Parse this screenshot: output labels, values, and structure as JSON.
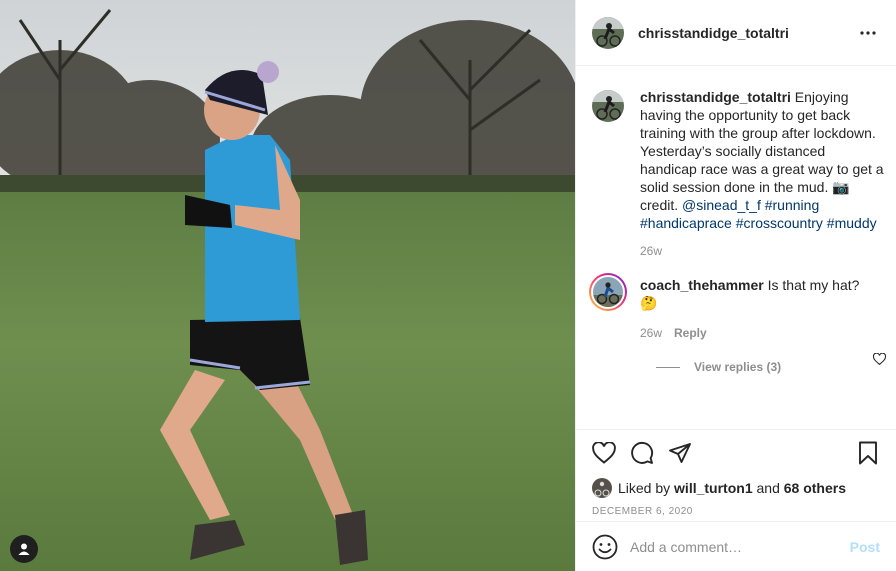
{
  "header": {
    "username": "chrisstandidge_totaltri",
    "more_icon": "more-horizontal-icon"
  },
  "caption": {
    "username": "chrisstandidge_totaltri",
    "text_before": " Enjoying having the opportunity to get back training with the group after lockdown. Yesterday’s socially distanced handicap race was a great way to get a solid session done in the mud. 📷credit. ",
    "mention": "@sinead_t_f",
    "hashtags": [
      "#running",
      "#handicaprace",
      "#crosscountry",
      "#muddy"
    ],
    "age": "26w"
  },
  "comments": [
    {
      "username": "coach_thehammer",
      "text": " Is that my hat? 🤔",
      "age": "26w",
      "reply_label": "Reply",
      "view_replies_label": "View replies (3)"
    }
  ],
  "actions": {
    "like_icon": "heart-icon",
    "comment_icon": "comment-icon",
    "share_icon": "share-icon",
    "save_icon": "bookmark-icon"
  },
  "likes": {
    "prefix": "Liked by ",
    "user": "will_turton1",
    "middle": " and ",
    "others": "68 others"
  },
  "date": "December 6, 2020",
  "add_comment": {
    "placeholder": "Add a comment…",
    "post_label": "Post",
    "emoji_icon": "smiley-icon"
  },
  "colors": {
    "link": "#00376b",
    "muted": "#8e8e8e",
    "post_disabled": "#b2dffc"
  }
}
